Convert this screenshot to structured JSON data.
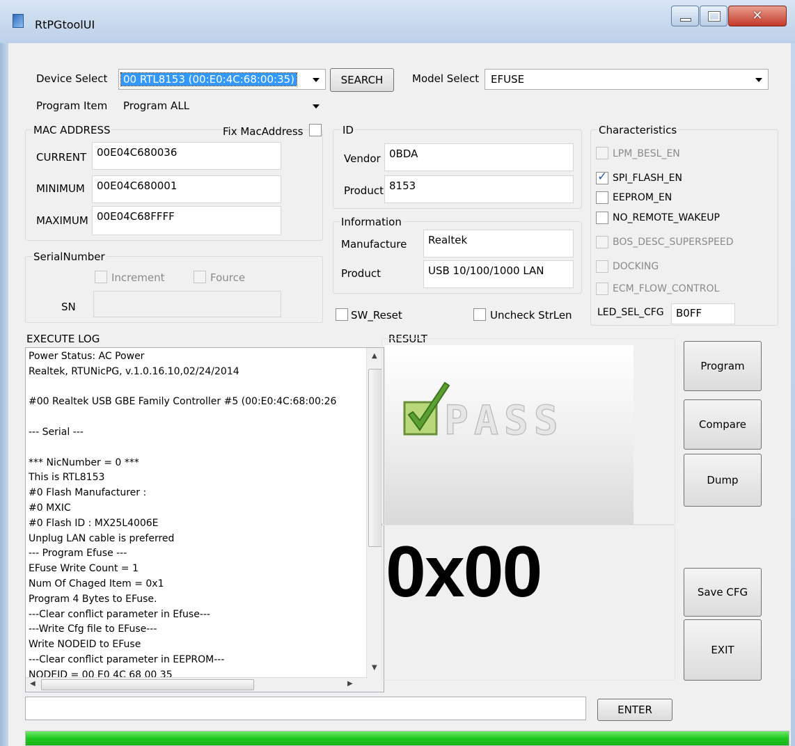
{
  "window": {
    "title": "RtPGtoolUI"
  },
  "device_select": {
    "label": "Device Select",
    "value": "00 RTL8153 (00:E0:4C:68:00:35)"
  },
  "search_button": "SEARCH",
  "model_select": {
    "label": "Model Select",
    "value": "EFUSE"
  },
  "program_item": {
    "label": "Program Item",
    "value": "Program ALL"
  },
  "mac": {
    "title": "MAC ADDRESS",
    "fix_label": "Fix MacAddress",
    "fix_checked": false,
    "current_label": "CURRENT",
    "current": "00E04C680036",
    "minimum_label": "MINIMUM",
    "minimum": "00E04C680001",
    "maximum_label": "MAXIMUM",
    "maximum": "00E04C68FFFF"
  },
  "serial": {
    "title": "SerialNumber",
    "increment_label": "Increment",
    "fource_label": "Fource",
    "sn_label": "SN",
    "sn_value": ""
  },
  "id": {
    "title": "ID",
    "vendor_label": "Vendor",
    "vendor": "0BDA",
    "product_label": "Product",
    "product": "8153"
  },
  "information": {
    "title": "Information",
    "manufacture_label": "Manufacture",
    "manufacture": "Realtek",
    "product_label": "Product",
    "product": "USB 10/100/1000 LAN"
  },
  "sw_reset_label": "SW_Reset",
  "uncheck_strlen_label": "Uncheck StrLen",
  "characteristics": {
    "title": "Characteristics",
    "items": [
      {
        "label": "LPM_BESL_EN",
        "checked": false,
        "enabled": false
      },
      {
        "label": "SPI_FLASH_EN",
        "checked": true,
        "enabled": true
      },
      {
        "label": "EEPROM_EN",
        "checked": false,
        "enabled": true
      },
      {
        "label": "NO_REMOTE_WAKEUP",
        "checked": false,
        "enabled": true
      },
      {
        "label": "BOS_DESC_SUPERSPEED",
        "checked": false,
        "enabled": false
      },
      {
        "label": "DOCKING",
        "checked": false,
        "enabled": false
      },
      {
        "label": "ECM_FLOW_CONTROL",
        "checked": false,
        "enabled": false
      }
    ],
    "led_label": "LED_SEL_CFG",
    "led_value": "B0FF"
  },
  "log": {
    "title": "EXECUTE LOG",
    "lines": [
      "Power Status: AC Power",
      "Realtek, RTUNicPG, v.1.0.16.10,02/24/2014",
      "",
      "#00 Realtek USB GBE Family Controller #5 (00:E0:4C:68:00:26",
      "",
      " --- Serial ---",
      "",
      "*** NicNumber = 0 ***",
      "This is RTL8153",
      "#0  Flash Manufacturer :",
      "#0 MXIC",
      "#0  Flash ID : MX25L4006E",
      " Unplug LAN cable is preferred",
      "--- Program Efuse ---",
      "EFuse Write Count = 1",
      "Num Of Chaged Item = 0x1",
      "Program 4 Bytes to EFuse.",
      "---Clear conflict parameter in Efuse---",
      "---Write Cfg file to EFuse---",
      " Write NODEID to EFuse",
      "---Clear conflict parameter in EEPROM---",
      "NODEID = 00 E0 4C 68 00 35"
    ]
  },
  "result": {
    "title": "RESULT",
    "image_text": "PASS",
    "code": "0x00"
  },
  "buttons": {
    "program": "Program",
    "compare": "Compare",
    "dump": "Dump",
    "save_cfg": "Save CFG",
    "exit": "EXIT",
    "enter": "ENTER"
  },
  "command_input": "",
  "progress": {
    "percent": 100,
    "color": "#1fc81f"
  }
}
